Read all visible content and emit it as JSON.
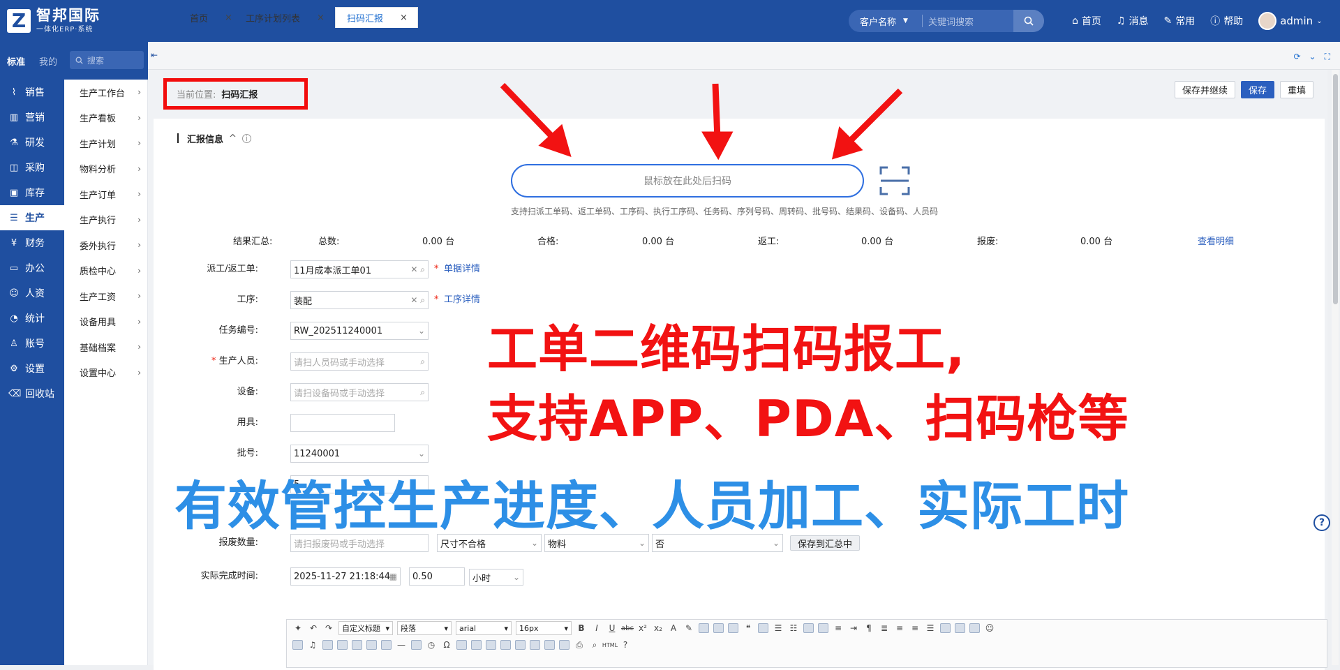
{
  "app": {
    "logo_letter": "Z",
    "name": "智邦国际",
    "subtitle": "一体化ERP·系统"
  },
  "top_search": {
    "selector": "客户名称",
    "placeholder": "关键词搜索"
  },
  "top_nav": [
    {
      "label": "首页",
      "icon": "home-icon"
    },
    {
      "label": "消息",
      "icon": "bell-icon"
    },
    {
      "label": "常用",
      "icon": "wrench-icon"
    },
    {
      "label": "帮助",
      "icon": "help-icon"
    }
  ],
  "user": {
    "name": "admin"
  },
  "sidebar": {
    "tabs": [
      "标准",
      "我的"
    ],
    "items": [
      {
        "label": "销售",
        "icon": "chart-icon"
      },
      {
        "label": "营销",
        "icon": "bar-icon"
      },
      {
        "label": "研发",
        "icon": "flask-icon"
      },
      {
        "label": "采购",
        "icon": "basket-icon"
      },
      {
        "label": "库存",
        "icon": "box-icon"
      },
      {
        "label": "生产",
        "icon": "factory-icon"
      },
      {
        "label": "财务",
        "icon": "yen-icon"
      },
      {
        "label": "办公",
        "icon": "briefcase-icon"
      },
      {
        "label": "人资",
        "icon": "people-icon"
      },
      {
        "label": "统计",
        "icon": "pie-icon"
      },
      {
        "label": "账号",
        "icon": "user-icon"
      },
      {
        "label": "设置",
        "icon": "gear-icon"
      },
      {
        "label": "回收站",
        "icon": "trash-icon"
      }
    ],
    "active_index": 5
  },
  "subnav": {
    "search_placeholder": "搜索",
    "items": [
      "生产工作台",
      "生产看板",
      "生产计划",
      "物料分析",
      "生产订单",
      "生产执行",
      "委外执行",
      "质检中心",
      "生产工资",
      "设备用具",
      "基础档案",
      "设置中心"
    ]
  },
  "tabs": [
    {
      "label": "首页"
    },
    {
      "label": "工序计划列表"
    },
    {
      "label": "扫码汇报"
    }
  ],
  "breadcrumb": {
    "label": "当前位置:",
    "current": "扫码汇报"
  },
  "actions": {
    "save_continue": "保存并继续",
    "save": "保存",
    "reset": "重填"
  },
  "section": {
    "title": "汇报信息"
  },
  "scan": {
    "placeholder": "鼠标放在此处后扫码",
    "hint": "支持扫派工单码、返工单码、工序码、执行工序码、任务码、序列号码、周转码、批号码、结果码、设备码、人员码"
  },
  "summary": {
    "label": "结果汇总:",
    "total_label": "总数:",
    "total_value": "0.00 台",
    "qualified_label": "合格:",
    "qualified_value": "0.00 台",
    "rework_label": "返工:",
    "rework_value": "0.00 台",
    "scrap_label": "报废:",
    "scrap_value": "0.00 台",
    "detail_link": "查看明细"
  },
  "form": {
    "dispatch_label": "派工/返工单:",
    "dispatch_value": "11月成本派工单01",
    "dispatch_link": "单据详情",
    "process_label": "工序:",
    "process_value": "装配",
    "process_link": "工序详情",
    "task_label": "任务编号:",
    "task_value": "RW_202511240001",
    "worker_label": "生产人员:",
    "worker_placeholder": "请扫人员码或手动选择",
    "device_label": "设备:",
    "device_placeholder": "请扫设备码或手动选择",
    "tool_label": "用具:",
    "tool_value": "",
    "batch_label": "批号:",
    "batch_value": "11240001",
    "qty_value": "5",
    "scrap_qty_label": "报废数量:",
    "scrap_qty_placeholder": "请扫报废码或手动选择",
    "scrap_reason": "尺寸不合格",
    "scrap_type": "物料",
    "scrap_flag": "否",
    "save_to_summary": "保存到汇总中",
    "finish_time_label": "实际完成时间:",
    "finish_time_value": "2025-11-27 21:18:44",
    "hours_value": "0.50",
    "hours_unit": "小时"
  },
  "editor": {
    "heading_select": "自定义标题",
    "paragraph_select": "段落",
    "font_select": "arial",
    "size_select": "16px"
  },
  "annotations": {
    "red_line1": "工单二维码扫码报工,",
    "red_line2": "支持APP、PDA、扫码枪等",
    "blue_line": "有效管控生产进度、人员加工、实际工时"
  },
  "colors": {
    "brand": "#1f4fa0",
    "accent": "#2b5fbf",
    "annotation_red": "#f21212",
    "annotation_blue": "#2d8fe6"
  }
}
